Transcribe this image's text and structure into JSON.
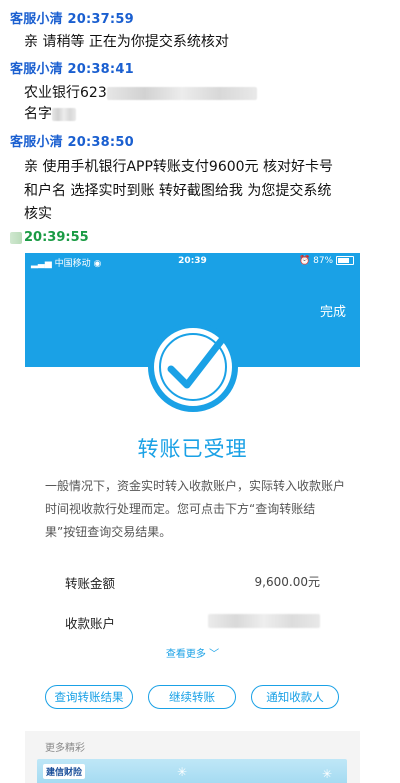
{
  "chat": {
    "messages": [
      {
        "sender": "客服小清",
        "time": "20:37:59",
        "lines": [
          "亲 请稍等 正在为你提交系统核对"
        ]
      },
      {
        "sender": "客服小清",
        "time": "20:38:41",
        "lines": [
          "农业银行623",
          "名字"
        ]
      },
      {
        "sender": "客服小清",
        "time": "20:38:50",
        "lines": [
          "亲  使用手机银行APP转账支付9600元  核对好卡号",
          "和户名  选择实时到账  转好截图给我 为您提交系统",
          "核实"
        ]
      }
    ],
    "user_time": "20:39:55"
  },
  "screenshot": {
    "status": {
      "carrier": "中国移动",
      "time": "20:39",
      "battery": "87%"
    },
    "done_label": "完成",
    "title": "转账已受理",
    "description": "一般情况下，资金实时转入收款账户，实际转入收款账户时间视收款行处理而定。您可点击下方“查询转账结果”按钮查询交易结果。",
    "rows": [
      {
        "label": "转账金额",
        "value": "9,600.00元"
      },
      {
        "label": "收款账户",
        "value": ""
      }
    ],
    "see_more": "查看更多",
    "buttons": [
      "查询转账结果",
      "继续转账",
      "通知收款人"
    ],
    "more_title": "更多精彩",
    "banner_logo": "建信财险"
  },
  "colors": {
    "accent": "#1aa1e6",
    "sender": "#1a5fd0",
    "user_time": "#1a9b44"
  }
}
